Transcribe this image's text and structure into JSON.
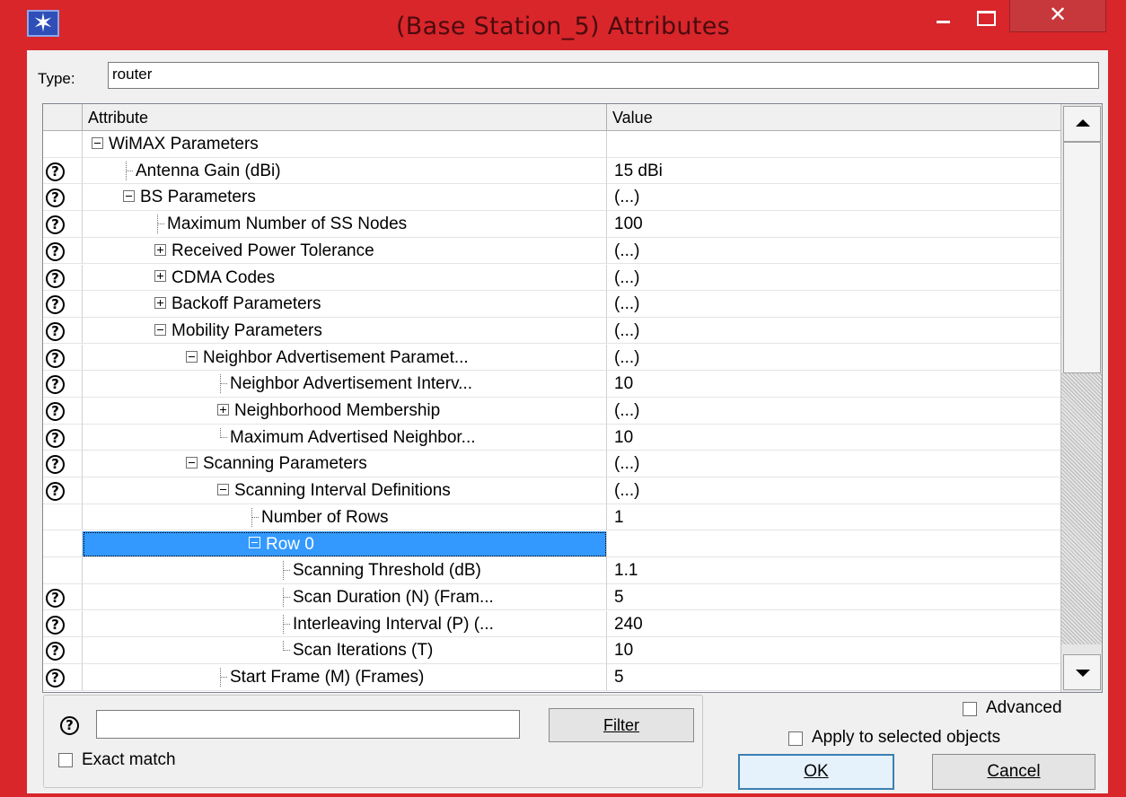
{
  "window": {
    "title": "(Base Station_5) Attributes",
    "close_glyph": "✕",
    "app_icon": "✶"
  },
  "type_field": {
    "label": "Type:",
    "value": "router"
  },
  "table": {
    "columns": [
      "Attribute",
      "Value"
    ],
    "rows": [
      {
        "help": false,
        "depth": 0,
        "node": "minus",
        "label": "WiMAX Parameters",
        "value": ""
      },
      {
        "help": true,
        "depth": 1,
        "node": "leaf",
        "label": "Antenna Gain (dBi)",
        "value": "15 dBi"
      },
      {
        "help": true,
        "depth": 1,
        "node": "minus",
        "label": "BS Parameters",
        "value": "(...)"
      },
      {
        "help": true,
        "depth": 2,
        "node": "leaf",
        "label": "Maximum Number of SS Nodes",
        "value": "100"
      },
      {
        "help": true,
        "depth": 2,
        "node": "plus",
        "label": "Received Power Tolerance",
        "value": "(...)"
      },
      {
        "help": true,
        "depth": 2,
        "node": "plus",
        "label": "CDMA Codes",
        "value": "(...)"
      },
      {
        "help": true,
        "depth": 2,
        "node": "plus",
        "label": "Backoff Parameters",
        "value": "(...)"
      },
      {
        "help": true,
        "depth": 2,
        "node": "minus",
        "label": "Mobility Parameters",
        "value": "(...)"
      },
      {
        "help": true,
        "depth": 3,
        "node": "minus",
        "label": "Neighbor Advertisement Paramet...",
        "value": "(...)"
      },
      {
        "help": true,
        "depth": 4,
        "node": "leaf",
        "label": "Neighbor Advertisement Interv...",
        "value": "10"
      },
      {
        "help": true,
        "depth": 4,
        "node": "plus",
        "label": "Neighborhood Membership",
        "value": "(...)"
      },
      {
        "help": true,
        "depth": 4,
        "node": "leaf-last",
        "label": "Maximum Advertised Neighbor...",
        "value": "10"
      },
      {
        "help": true,
        "depth": 3,
        "node": "minus",
        "label": "Scanning Parameters",
        "value": "(...)"
      },
      {
        "help": true,
        "depth": 4,
        "node": "minus",
        "label": "Scanning Interval Definitions",
        "value": "(...)"
      },
      {
        "help": false,
        "depth": 5,
        "node": "leaf",
        "label": "Number of Rows",
        "value": "1"
      },
      {
        "help": false,
        "depth": 5,
        "node": "minus",
        "label": "Row 0",
        "value": "",
        "selected": true
      },
      {
        "help": false,
        "depth": 6,
        "node": "leaf",
        "label": "Scanning Threshold (dB)",
        "value": "1.1"
      },
      {
        "help": true,
        "depth": 6,
        "node": "leaf",
        "label": "Scan Duration (N) (Fram...",
        "value": "5"
      },
      {
        "help": true,
        "depth": 6,
        "node": "leaf",
        "label": "Interleaving Interval (P) (...",
        "value": "240"
      },
      {
        "help": true,
        "depth": 6,
        "node": "leaf-last",
        "label": "Scan Iterations (T)",
        "value": "10"
      },
      {
        "help": true,
        "depth": 4,
        "node": "leaf",
        "label": "Start Frame (M) (Frames)",
        "value": "5"
      }
    ]
  },
  "filter": {
    "input_value": "",
    "button_label": "Filter",
    "exact_match_label": "Exact match"
  },
  "options": {
    "advanced_label": "Advanced",
    "apply_selected_label": "Apply to selected objects"
  },
  "buttons": {
    "ok": "OK",
    "cancel": "Cancel"
  },
  "icons": {
    "help": "?"
  },
  "colors": {
    "titlebar": "#d8262b",
    "selection": "#3399ff",
    "close_button": "#c7383c"
  }
}
